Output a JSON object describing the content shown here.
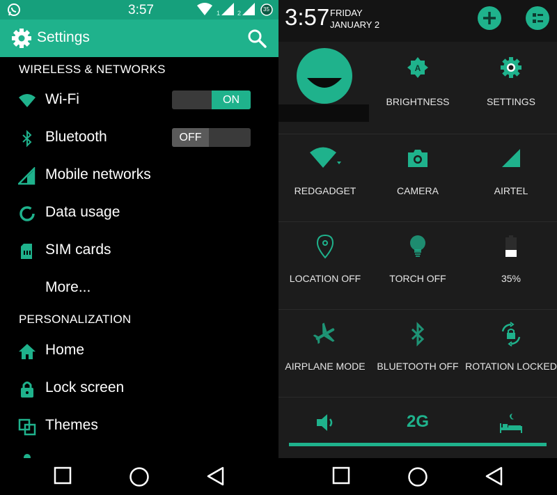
{
  "colors": {
    "accent": "#1fb28c",
    "accent_dark": "#16a07c",
    "background": "#000000",
    "panel": "#1c1c1c"
  },
  "left": {
    "status_bar": {
      "time": "3:57",
      "icons": [
        "whatsapp-icon",
        "wifi-icon",
        "signal-sim1-icon",
        "signal-sim2-icon",
        "battery-icon"
      ],
      "sim1_label": "1",
      "sim2_label": "2",
      "battery_level": "35"
    },
    "app_bar": {
      "title": "Settings",
      "icons": [
        "gear-icon",
        "search-icon"
      ]
    },
    "sections": {
      "wireless": "WIRELESS & NETWORKS",
      "personalization": "PERSONALIZATION"
    },
    "items": {
      "wifi": {
        "label": "Wi-Fi",
        "icon": "wifi-icon",
        "toggle": "ON"
      },
      "bluetooth": {
        "label": "Bluetooth",
        "icon": "bluetooth-icon",
        "toggle": "OFF"
      },
      "mobile": {
        "label": "Mobile networks",
        "icon": "signal-icon"
      },
      "data": {
        "label": "Data usage",
        "icon": "data-usage-icon"
      },
      "sim": {
        "label": "SIM cards",
        "icon": "sim-card-icon"
      },
      "more": {
        "label": "More..."
      },
      "home": {
        "label": "Home",
        "icon": "home-icon"
      },
      "lock": {
        "label": "Lock screen",
        "icon": "lock-icon"
      },
      "themes": {
        "label": "Themes",
        "icon": "themes-icon"
      }
    }
  },
  "right": {
    "header": {
      "time": "3:57",
      "day": "FRIDAY",
      "date": "JANUARY 2",
      "buttons": [
        "add-icon",
        "list-icon"
      ]
    },
    "tiles": {
      "user": {
        "icon": "user-avatar-icon"
      },
      "brightness": {
        "label": "BRIGHTNESS",
        "icon": "brightness-icon"
      },
      "settings": {
        "label": "SETTINGS",
        "icon": "gear-icon"
      },
      "wifi": {
        "label": "REDGADGET",
        "icon": "wifi-icon"
      },
      "camera": {
        "label": "CAMERA",
        "icon": "camera-icon"
      },
      "mobile": {
        "label": "AIRTEL",
        "icon": "signal-icon"
      },
      "location": {
        "label": "LOCATION OFF",
        "icon": "location-icon"
      },
      "torch": {
        "label": "TORCH OFF",
        "icon": "torch-icon"
      },
      "battery": {
        "label": "35%",
        "icon": "battery-icon"
      },
      "airplane": {
        "label": "AIRPLANE MODE",
        "icon": "airplane-icon"
      },
      "bluetooth": {
        "label": "BLUETOOTH OFF",
        "icon": "bluetooth-icon"
      },
      "rotation": {
        "label": "ROTATION LOCKED",
        "icon": "rotation-lock-icon"
      },
      "volume": {
        "icon": "volume-icon"
      },
      "network_type": {
        "label": "2G",
        "icon": "network-2g-icon"
      },
      "sleep": {
        "icon": "sleep-icon"
      }
    }
  },
  "nav": {
    "icons": [
      "recents-icon",
      "home-icon",
      "back-icon"
    ]
  }
}
